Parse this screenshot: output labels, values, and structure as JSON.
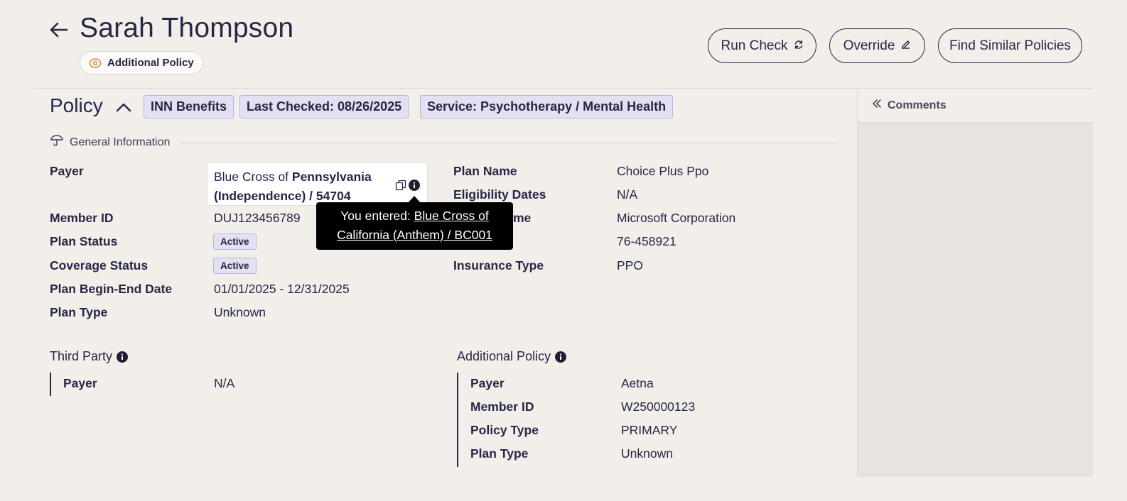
{
  "header": {
    "patient_name": "Sarah Thompson",
    "policy_pill": "Additional Policy",
    "buttons": {
      "run_check": "Run Check",
      "override": "Override",
      "find_similar": "Find Similar Policies"
    }
  },
  "policy": {
    "title": "Policy",
    "tags": [
      "INN Benefits",
      "Last Checked: 08/26/2025",
      "Service: Psychotherapy / Mental Health"
    ]
  },
  "general_info": {
    "heading": "General Information",
    "left": {
      "payer_label": "Payer",
      "payer_prefix": "Blue Cross of ",
      "payer_bold_1": "Pennsylvania",
      "payer_bold_2": "(Independence) / 54704",
      "member_id_label": "Member ID",
      "member_id": "DUJ123456789",
      "plan_status_label": "Plan Status",
      "plan_status": "Active",
      "coverage_status_label": "Coverage Status",
      "coverage_status": "Active",
      "plan_dates_label": "Plan Begin-End Date",
      "plan_dates": "01/01/2025 - 12/31/2025",
      "plan_type_label": "Plan Type",
      "plan_type": "Unknown"
    },
    "right": {
      "plan_name_label": "Plan Name",
      "plan_name": "Choice Plus Ppo",
      "eligibility_label": "Eligibility Dates",
      "eligibility": "N/A",
      "group_label_partial": "me",
      "group_name": "Microsoft Corporation",
      "group_number": "76-458921",
      "insurance_type_label": "Insurance Type",
      "insurance_type": "PPO"
    }
  },
  "tooltip": {
    "prefix": "You entered: ",
    "link_line1": "Blue Cross of",
    "link_line2": "California (Anthem) / BC001"
  },
  "third_party": {
    "heading": "Third Party",
    "payer_label": "Payer",
    "payer": "N/A"
  },
  "additional_policy": {
    "heading": "Additional Policy",
    "payer_label": "Payer",
    "payer": "Aetna",
    "member_id_label": "Member ID",
    "member_id": "W250000123",
    "policy_type_label": "Policy Type",
    "policy_type": "PRIMARY",
    "plan_type_label": "Plan Type",
    "plan_type": "Unknown"
  },
  "comments": {
    "label": "Comments"
  },
  "colors": {
    "background": "#f2efea",
    "text": "#2a2547",
    "tag_bg": "#e3e0f2",
    "tag_border": "#b9b4e0",
    "comments_bg": "#e7e4df",
    "tooltip_bg": "#000000"
  }
}
